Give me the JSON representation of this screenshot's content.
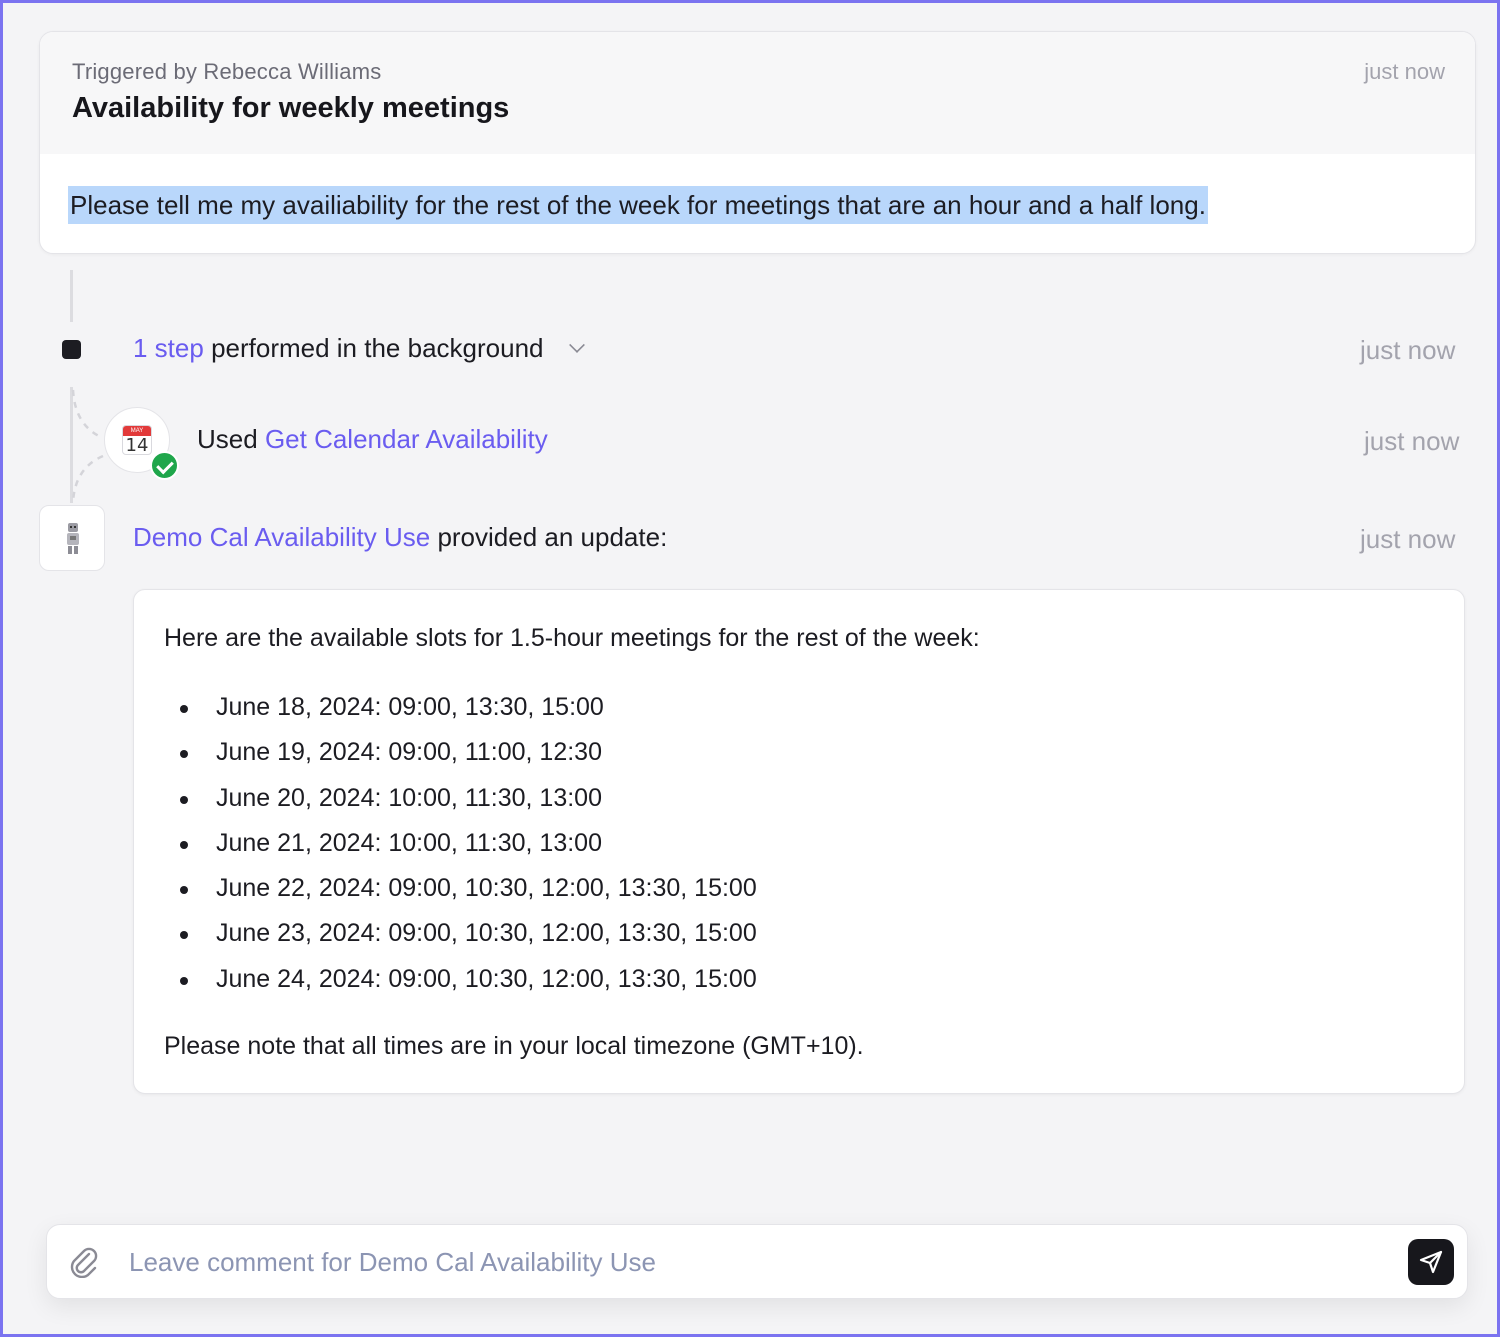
{
  "trigger": {
    "triggered_by": "Triggered by Rebecca Williams",
    "title": "Availability for weekly meetings",
    "time": "just now",
    "prompt": "Please tell me my availiability for the rest of the week for meetings that are an hour and a half long."
  },
  "steps": {
    "count_label": "1 step",
    "label": "performed in the background",
    "time": "just now"
  },
  "tool_use": {
    "prefix": "Used",
    "tool_name": "Get Calendar Availability",
    "time": "just now",
    "icon": "calendar-icon",
    "calendar_month": "MAY",
    "calendar_day": "14"
  },
  "agent_update": {
    "agent_name": "Demo Cal Availability Use",
    "suffix": "provided an update:",
    "time": "just now"
  },
  "reply": {
    "intro": "Here are the available slots for 1.5-hour meetings for the rest of the week:",
    "slots": [
      "June 18, 2024: 09:00, 13:30, 15:00",
      "June 19, 2024: 09:00, 11:00, 12:30",
      "June 20, 2024: 10:00, 11:30, 13:00",
      "June 21, 2024: 10:00, 11:30, 13:00",
      "June 22, 2024: 09:00, 10:30, 12:00, 13:30, 15:00",
      "June 23, 2024: 09:00, 10:30, 12:00, 13:30, 15:00",
      "June 24, 2024: 09:00, 10:30, 12:00, 13:30, 15:00"
    ],
    "note": "Please note that all times are in your local timezone (GMT+10)."
  },
  "comment": {
    "placeholder": "Leave comment for Demo Cal Availability Use",
    "attach_icon": "paperclip-icon",
    "send_icon": "send-icon"
  },
  "colors": {
    "accent": "#6a5cf0",
    "frame_border": "#7b73f0",
    "success": "#1fa64b",
    "highlight": "#b9d7fb"
  }
}
